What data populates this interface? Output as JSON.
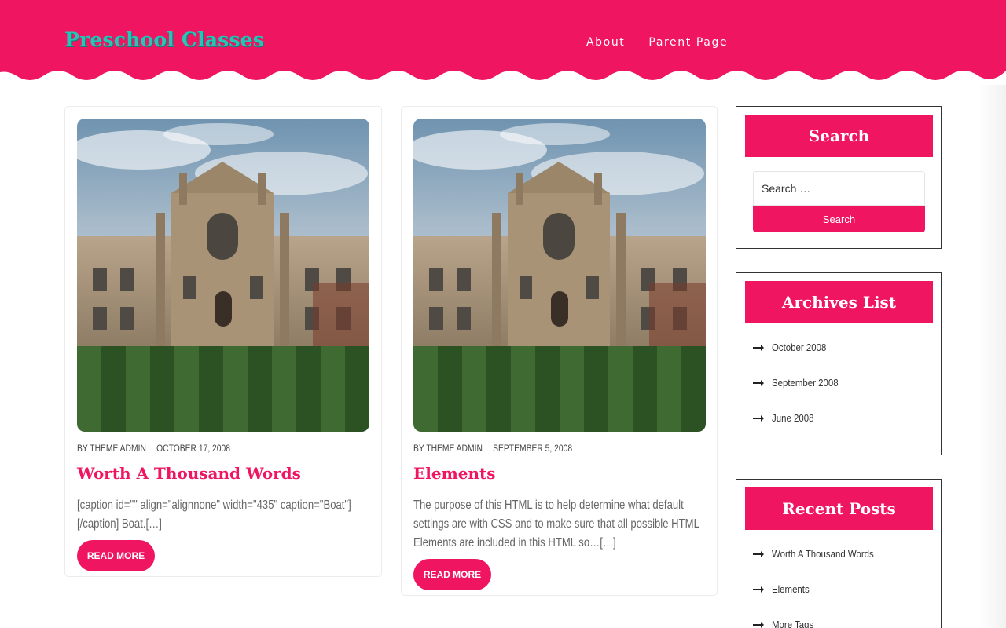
{
  "site": {
    "title": "Preschool Classes",
    "brand_color": "#ef1561",
    "title_color": "#2cc3b7"
  },
  "nav": {
    "items": [
      {
        "label": "About"
      },
      {
        "label": "Parent Page"
      }
    ]
  },
  "posts": [
    {
      "author": "BY THEME ADMIN",
      "date": "OCTOBER 17, 2008",
      "title": "Worth A Thousand Words",
      "excerpt": "[caption id=\"\" align=\"alignnone\" width=\"435\" caption=\"Boat\"][/caption] Boat.[…]",
      "read_more": "READ MORE",
      "image": "college-building-lawn"
    },
    {
      "author": "BY THEME ADMIN",
      "date": "SEPTEMBER 5, 2008",
      "title": "Elements",
      "excerpt": "The purpose of this HTML is to help determine what default settings are with CSS and to make sure that all possible HTML Elements are included in this HTML so…[…]",
      "read_more": "READ MORE",
      "image": "college-building-lawn"
    }
  ],
  "sidebar": {
    "search": {
      "title": "Search",
      "placeholder": "Search …",
      "button": "Search"
    },
    "archives": {
      "title": "Archives List",
      "items": [
        "October 2008",
        "September 2008",
        "June 2008"
      ]
    },
    "recent": {
      "title": "Recent Posts",
      "items": [
        "Worth A Thousand Words",
        "Elements",
        "More Tags"
      ]
    },
    "icons": {
      "list_bullet": "arrow-right-icon"
    }
  }
}
